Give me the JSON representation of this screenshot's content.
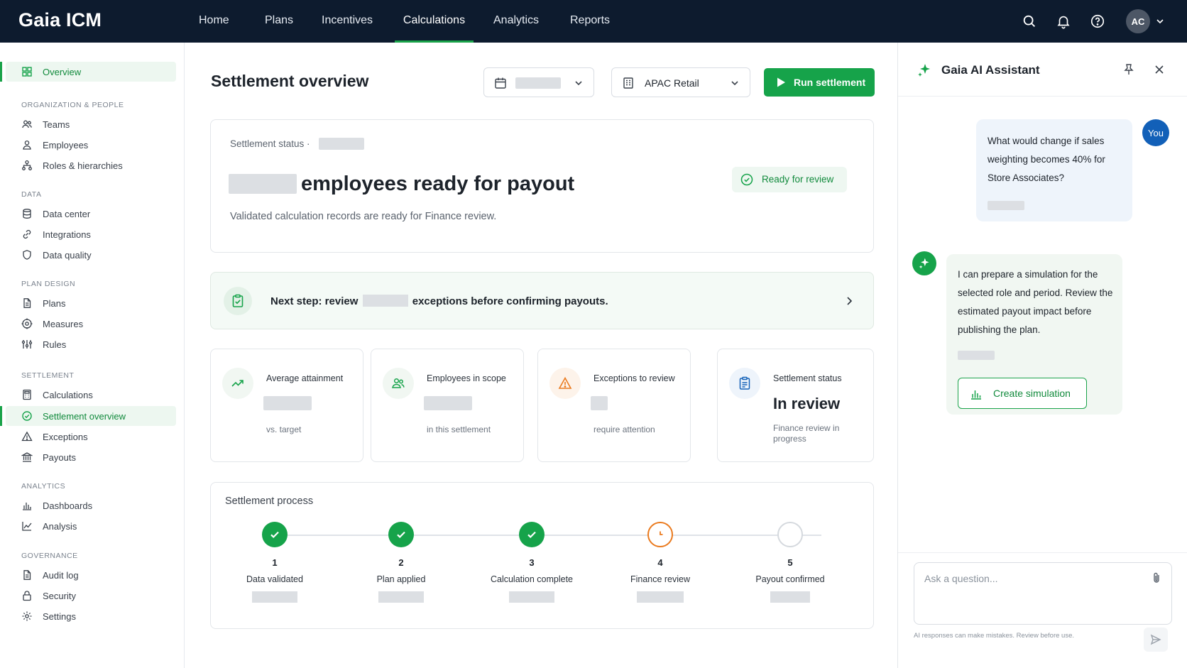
{
  "app": {
    "name": "Gaia ICM",
    "user_initials": "AC"
  },
  "nav": {
    "items": [
      {
        "label": "Home"
      },
      {
        "label": "Plans"
      },
      {
        "label": "Incentives"
      },
      {
        "label": "Calculations",
        "active": true
      },
      {
        "label": "Analytics"
      },
      {
        "label": "Reports"
      }
    ],
    "icons": [
      "search-icon",
      "bell-icon",
      "help-icon"
    ]
  },
  "sidebar": {
    "overview": "Overview",
    "sections": [
      {
        "title": "ORGANIZATION & PEOPLE",
        "items": [
          "Teams",
          "Employees",
          "Roles & hierarchies"
        ]
      },
      {
        "title": "DATA",
        "items": [
          "Data center",
          "Integrations",
          "Data quality"
        ]
      },
      {
        "title": "PLAN DESIGN",
        "items": [
          "Plans",
          "Measures",
          "Rules"
        ]
      },
      {
        "title": "SETTLEMENT",
        "items": [
          "Calculations",
          "Settlement overview",
          "Exceptions",
          "Payouts"
        ]
      },
      {
        "title": "ANALYTICS",
        "items": [
          "Dashboards",
          "Analysis"
        ]
      },
      {
        "title": "GOVERNANCE",
        "items": [
          "Audit log",
          "Security",
          "Settings"
        ]
      }
    ],
    "active_item": "Settlement overview"
  },
  "main": {
    "title": "Settlement overview",
    "region_select": "APAC Retail",
    "run_button": "Run settlement",
    "status_card": {
      "label": "Settlement status ·",
      "headline": "employees ready for payout",
      "description": "Validated calculation records are ready for Finance review.",
      "badge": "Ready for review"
    },
    "next_step": {
      "prefix": "Next step: review",
      "suffix": "exceptions before confirming payouts."
    },
    "kpis": [
      {
        "title": "Average attainment",
        "sub": "vs. target"
      },
      {
        "title": "Employees in scope",
        "sub": "in this settlement"
      },
      {
        "title": "Exceptions to review",
        "sub": "require attention"
      },
      {
        "title": "Settlement status",
        "value": "In review",
        "sub": "Finance review in progress"
      }
    ],
    "process": {
      "title": "Settlement process",
      "steps": [
        {
          "num": "1",
          "label": "Data validated",
          "state": "done"
        },
        {
          "num": "2",
          "label": "Plan applied",
          "state": "done"
        },
        {
          "num": "3",
          "label": "Calculation complete",
          "state": "done"
        },
        {
          "num": "4",
          "label": "Finance review",
          "state": "current"
        },
        {
          "num": "5",
          "label": "Payout confirmed",
          "state": "pending"
        }
      ]
    }
  },
  "assistant": {
    "title": "Gaia AI Assistant",
    "user_label": "You",
    "user_message": "What would change if sales weighting becomes 40% for Store Associates?",
    "ai_message": "I can prepare a simulation for the selected role and period. Review the estimated payout impact before publishing the plan.",
    "simulation_button": "Create simulation",
    "input_placeholder": "Ask a question...",
    "disclaimer": "AI responses can make mistakes. Review before use."
  },
  "colors": {
    "brand_green": "#16a34a",
    "topbar": "#0d1b2e",
    "warning": "#ea7a1e",
    "user_blue": "#1260b8"
  }
}
